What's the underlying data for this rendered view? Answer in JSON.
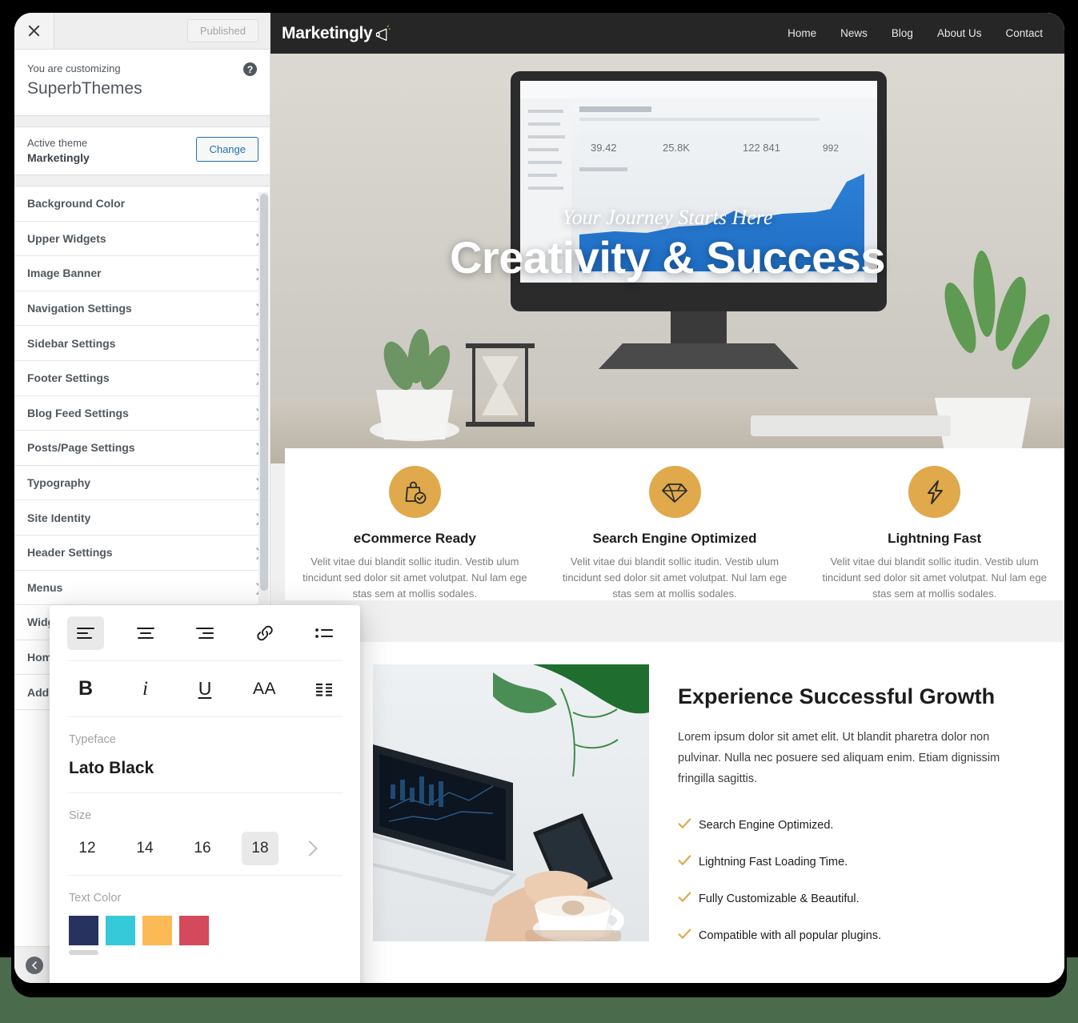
{
  "customizer": {
    "close_icon": "close-icon",
    "published_label": "Published",
    "help_icon": "help-icon",
    "heading_eyebrow": "You are customizing",
    "heading_title": "SuperbThemes",
    "active_theme_label": "Active theme",
    "active_theme_name": "Marketingly",
    "change_label": "Change",
    "collapse_label": "",
    "panels": [
      {
        "label": "Background Color"
      },
      {
        "label": "Upper Widgets"
      },
      {
        "label": "Image Banner"
      },
      {
        "label": "Navigation Settings"
      },
      {
        "label": "Sidebar Settings"
      },
      {
        "label": "Footer Settings"
      },
      {
        "label": "Blog Feed Settings"
      },
      {
        "label": "Posts/Page Settings"
      },
      {
        "label": "Typography"
      },
      {
        "label": "Site Identity"
      },
      {
        "label": "Header Settings"
      },
      {
        "label": "Menus"
      },
      {
        "label": "Widgets"
      },
      {
        "label": "Homepage Settings"
      },
      {
        "label": "Additional CSS"
      }
    ]
  },
  "typography_popup": {
    "align_left_icon": "align-left-icon",
    "align_center_icon": "align-center-icon",
    "align_right_icon": "align-right-icon",
    "link_icon": "link-icon",
    "bullet_list_icon": "bullet-list-icon",
    "bold_label": "B",
    "italic_label": "i",
    "underline_label": "U",
    "font_size_label": "AA",
    "justify_icon": "justify-icon",
    "typeface_label": "Typeface",
    "typeface_value": "Lato Black",
    "size_label": "Size",
    "sizes": [
      "12",
      "14",
      "16",
      "18"
    ],
    "size_selected": "18",
    "next_icon": "chevron-right-icon",
    "text_color_label": "Text Color",
    "swatches": [
      "#27325f",
      "#35c9da",
      "#fbba56",
      "#d4495c"
    ],
    "swatch_selected_index": 0
  },
  "site": {
    "logo_text": "Marketingly",
    "logo_icon": "megaphone-icon",
    "nav": [
      "Home",
      "News",
      "Blog",
      "About Us",
      "Contact"
    ],
    "hero": {
      "subtitle": "Your Journey Starts Here",
      "title": "Creativity & Success"
    },
    "features": [
      {
        "icon": "shopping-bag-check-icon",
        "title": "eCommerce Ready",
        "desc": "Velit vitae dui blandit sollic itudin. Vestib ulum tincidunt sed dolor sit amet volutpat. Nul lam ege stas sem at mollis sodales."
      },
      {
        "icon": "diamond-icon",
        "title": "Search Engine Optimized",
        "desc": "Velit vitae dui blandit sollic itudin. Vestib ulum tincidunt sed dolor sit amet volutpat. Nul lam ege stas sem at mollis sodales."
      },
      {
        "icon": "lightning-bolt-icon",
        "title": "Lightning Fast",
        "desc": "Velit vitae dui blandit sollic itudin. Vestib ulum tincidunt sed dolor sit amet volutpat. Nul lam ege stas sem at mollis sodales."
      }
    ],
    "growth": {
      "heading": "Experience Successful Growth",
      "paragraph": "Lorem ipsum dolor sit amet elit. Ut blandit pharetra dolor non pulvinar. Nulla nec posuere sed aliquam enim. Etiam dignissim fringilla sagittis.",
      "checklist": [
        "Search Engine Optimized.",
        "Lightning Fast Loading Time.",
        "Fully Customizable & Beautiful.",
        "Compatible with all popular plugins."
      ]
    }
  },
  "colors": {
    "accent_gold": "#dfa94c",
    "header_dark": "#262626",
    "backdrop_green": "#4b6b4d",
    "wp_blue": "#2271b1"
  }
}
